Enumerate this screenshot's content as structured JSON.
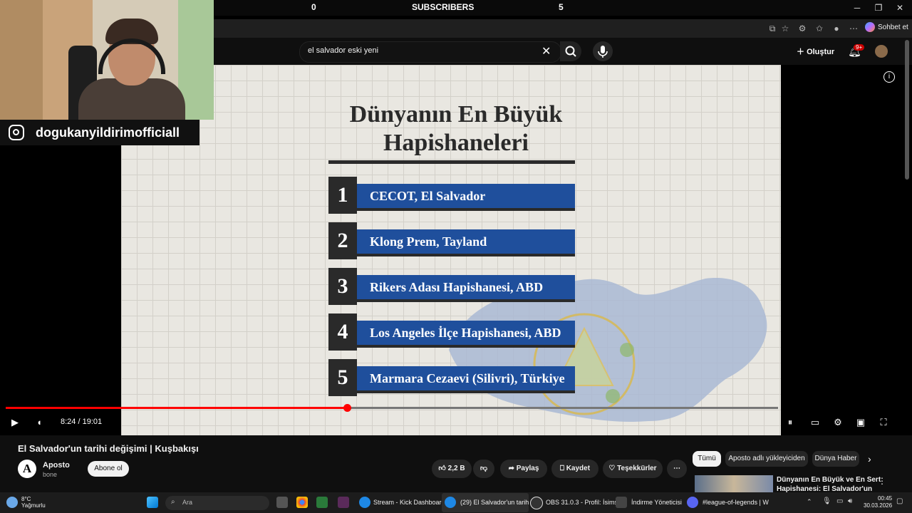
{
  "stream_overlay": {
    "left_count": "0",
    "label": "SUBSCRIBERS",
    "right_count": "5",
    "instagram_handle": "dogukanyildirimofficiall"
  },
  "browser": {
    "copilot_label": "Sohbet et"
  },
  "youtube_header": {
    "search_value": "el salvador eski yeni",
    "create_label": "Oluştur",
    "notifications_badge": "9+"
  },
  "video_slide": {
    "title_line1": "Dünyanın En Büyük",
    "title_line2": "Hapishaneleri",
    "items": [
      {
        "rank": "1",
        "label": "CECOT, El Salvador"
      },
      {
        "rank": "2",
        "label": "Klong Prem, Tayland"
      },
      {
        "rank": "3",
        "label": "Rikers Adası Hapishanesi, ABD"
      },
      {
        "rank": "4",
        "label": "Los Angeles İlçe Hapishanesi, ABD"
      },
      {
        "rank": "5",
        "label": "Marmara Cezaevi (Silivri), Türkiye"
      }
    ],
    "channel_mark": "A"
  },
  "player": {
    "time": "8:24 / 19:01",
    "progress_fraction": 0.4415
  },
  "video_info": {
    "title": "El Salvador'un tarihi değişimi | Kuşbakışı",
    "channel_name": "Aposto",
    "channel_avatar_letter": "A",
    "subs_text": "bone",
    "subscribe_label": "Abone ol",
    "likes": "2,2 B",
    "share_label": "Paylaş",
    "save_label": "Kaydet",
    "thanks_label": "Teşekkürler",
    "more_label": "⋯"
  },
  "recommendations": {
    "chips": [
      "Tümü",
      "Aposto adlı yükleyiciden",
      "Dünya Haber"
    ],
    "first_title": "Dünyanın En Büyük ve En Sert Hapishanesi: El Salvador'un"
  },
  "taskbar": {
    "weather_temp": "8°C",
    "weather_desc": "Yağmurlu",
    "search_placeholder": "Ara",
    "apps": [
      "Stream - Kick Dashboard",
      "(29) El Salvador'un tarih",
      "OBS 31.0.3 - Profil: İsims",
      "İndirme Yöneticisi",
      "#league-of-legends | W"
    ],
    "time": "00:45",
    "date": "30.03.2026"
  },
  "colors": {
    "progress_red": "#ff0000",
    "slide_blue": "#1f4f9c",
    "slide_dark": "#2a2a2a"
  }
}
